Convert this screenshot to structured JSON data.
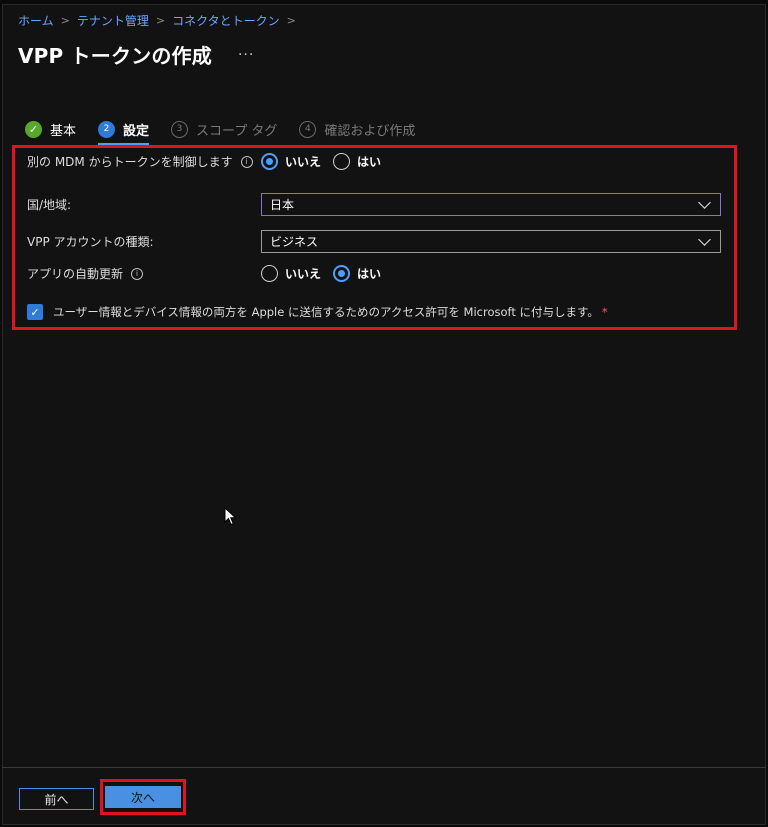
{
  "breadcrumb": [
    "ホーム",
    "テナント管理",
    "コネクタとトークン"
  ],
  "breadcrumb_sep": ">",
  "title": "VPP トークンの作成",
  "more": "···",
  "tabs": [
    {
      "label": "基本",
      "state": "done",
      "icon": "✓"
    },
    {
      "label": "設定",
      "state": "active",
      "icon": "2"
    },
    {
      "label": "スコープ タグ",
      "state": "disabled",
      "icon": "3"
    },
    {
      "label": "確認および作成",
      "state": "disabled",
      "icon": "4"
    }
  ],
  "form": {
    "mdm_control": {
      "label": "別の MDM からトークンを制御します",
      "options": [
        "いいえ",
        "はい"
      ],
      "selected": "いいえ"
    },
    "country": {
      "label": "国/地域:",
      "value": "日本"
    },
    "account_type": {
      "label": "VPP アカウントの種類:",
      "value": "ビジネス"
    },
    "auto_update": {
      "label": "アプリの自動更新",
      "options": [
        "いいえ",
        "はい"
      ],
      "selected": "はい"
    },
    "consent": {
      "label": "ユーザー情報とデバイス情報の両方を Apple に送信するためのアクセス許可を Microsoft に付与します。",
      "required_mark": "*",
      "checked": true
    }
  },
  "footer": {
    "prev_label": "前へ",
    "next_label": "次へ"
  },
  "colors": {
    "accent": "#4aa0ff",
    "highlight": "#e0141e",
    "done": "#57a82c"
  }
}
